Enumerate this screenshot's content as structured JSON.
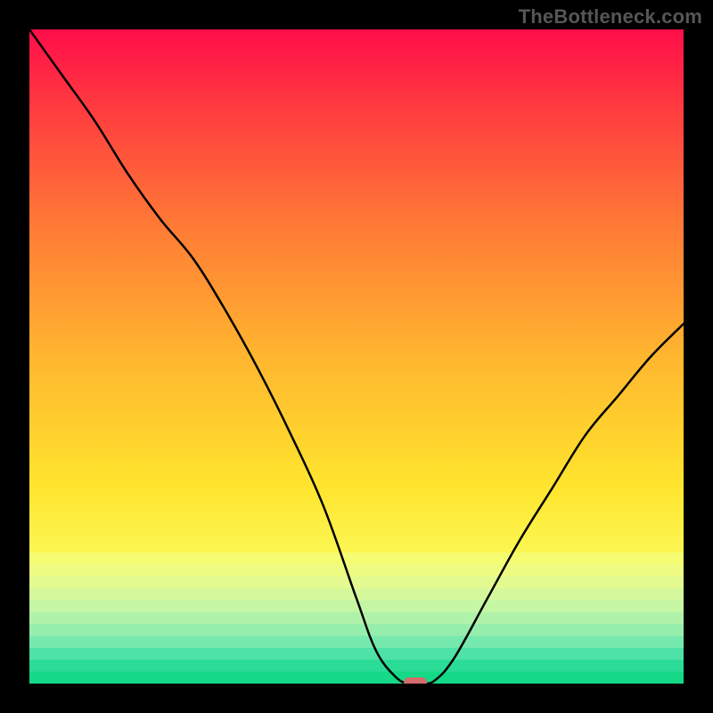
{
  "watermark": "TheBottleneck.com",
  "chart_data": {
    "type": "line",
    "title": "",
    "xlabel": "",
    "ylabel": "",
    "xlim": [
      0,
      100
    ],
    "ylim": [
      0,
      100
    ],
    "grid": false,
    "legend": false,
    "series": [
      {
        "name": "bottleneck-curve",
        "x": [
          0,
          5,
          10,
          15,
          20,
          25,
          30,
          35,
          40,
          45,
          50,
          53,
          56,
          58,
          60,
          62,
          65,
          70,
          75,
          80,
          85,
          90,
          95,
          100
        ],
        "values": [
          100,
          93,
          86,
          78,
          71,
          65,
          57,
          48,
          38,
          27,
          13,
          5,
          1,
          0,
          0,
          0.5,
          4,
          13,
          22,
          30,
          38,
          44,
          50,
          55
        ]
      }
    ],
    "marker": {
      "name": "bottleneck-marker",
      "x": 59,
      "y": 0,
      "color": "#d66b6b",
      "shape": "pill"
    },
    "background": {
      "type": "vertical-gradient-with-bands",
      "stops": [
        {
          "pos": 0.0,
          "color": "#ff0d4a"
        },
        {
          "pos": 0.12,
          "color": "#ff3b3f"
        },
        {
          "pos": 0.3,
          "color": "#ff7a36"
        },
        {
          "pos": 0.5,
          "color": "#ffb62f"
        },
        {
          "pos": 0.7,
          "color": "#ffe52e"
        },
        {
          "pos": 0.82,
          "color": "#fbf95a"
        },
        {
          "pos": 0.9,
          "color": "#edfb8e"
        },
        {
          "pos": 0.955,
          "color": "#c9f7a8"
        },
        {
          "pos": 0.985,
          "color": "#6ee8af"
        },
        {
          "pos": 1.0,
          "color": "#16d987"
        }
      ]
    }
  }
}
